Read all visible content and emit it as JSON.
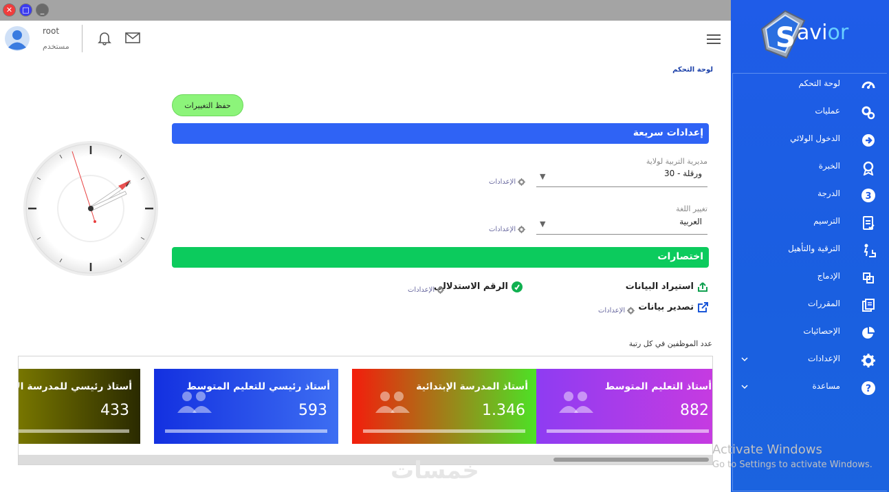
{
  "window": {
    "close_glyph": "✕",
    "max_glyph": "□",
    "min_glyph": "_"
  },
  "brand": {
    "logo_s": "S",
    "logo_text_a": "avi",
    "logo_text_b": "or",
    "colors": {
      "sidebar": "#1f5ce8",
      "accent_light": "#6ad0ff"
    }
  },
  "header": {
    "username": "root",
    "role": "مستخدم"
  },
  "breadcrumb": "لوحة التحكم",
  "sidebar": {
    "items": [
      {
        "label": "لوحة التحكم",
        "icon": "dashboard-gauge-icon"
      },
      {
        "label": "عمليات",
        "icon": "gears-icon"
      },
      {
        "label": "الدخول الولائي",
        "icon": "arrow-circle-right-icon"
      },
      {
        "label": "الخبرة",
        "icon": "award-icon"
      },
      {
        "label": "الدرجة",
        "icon": "number-3-circle-icon"
      },
      {
        "label": "الترسيم",
        "icon": "file-check-icon"
      },
      {
        "label": "الترقية والتأهيل",
        "icon": "stairs-person-icon"
      },
      {
        "label": "الإدماج",
        "icon": "merge-squares-icon"
      },
      {
        "label": "المقررات",
        "icon": "documents-icon"
      },
      {
        "label": "الإحصائيات",
        "icon": "pie-chart-icon"
      },
      {
        "label": "الإعدادات",
        "icon": "gear-icon"
      },
      {
        "label": "مساعدة",
        "icon": "question-circle-icon"
      }
    ]
  },
  "main": {
    "save_button": "حفظ التغييرات",
    "quick_settings": {
      "title": "إعدادات سريعة",
      "fields": [
        {
          "label": "مديرية التربية لولاية",
          "value": "30 - ورقلة",
          "settings_link": "الإعدادات"
        },
        {
          "label": "تغيير اللغة",
          "value": "العربية",
          "settings_link": "الإعدادات"
        }
      ]
    },
    "shortcuts": {
      "title": "اختصارات",
      "items": [
        {
          "label": "استيراد البيانات",
          "icon": "import-icon"
        },
        {
          "label": "الرقم الاستدلالى",
          "icon": "link-badge-icon",
          "settings_link": "الإعدادات"
        },
        {
          "label": "تصدير بيانات",
          "icon": "export-icon",
          "settings_link": "الإعدادات"
        }
      ]
    },
    "employees_title": "عدد الموظفين في كل رتبة",
    "cards": [
      {
        "title": "أستاذ التعليم المتوسط",
        "value": "882",
        "colors": [
          "#8e3cf2",
          "#c83be0"
        ]
      },
      {
        "title": "أستاذ المدرسة الإبتدائية",
        "value": "1.346",
        "colors": [
          "#f31d0c",
          "#4de126"
        ]
      },
      {
        "title": "أستاذ رئيسي للتعليم المتوسط",
        "value": "593",
        "colors": [
          "#1330e0",
          "#3d6ef2"
        ]
      },
      {
        "title": "أستاذ رئيسي للمدرسة الإبتدائية",
        "value": "433",
        "colors": [
          "#9f9d00",
          "#2a2a00"
        ]
      }
    ]
  },
  "os_overlay": {
    "activate_title": "Activate Windows",
    "activate_sub": "Go to Settings to activate Windows."
  },
  "watermark": "خمسات"
}
